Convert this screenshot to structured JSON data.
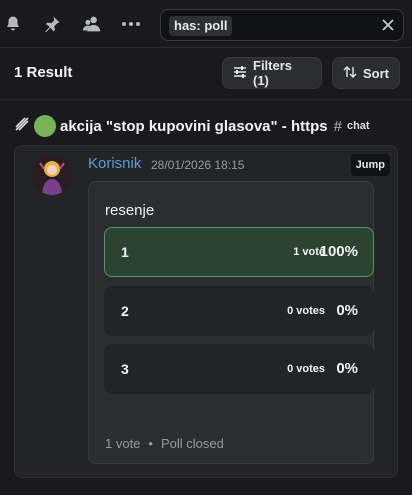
{
  "search": {
    "chip_text": "has: poll"
  },
  "results": {
    "count_label": "1 Result",
    "filters_label": "Filters (1)",
    "sort_label": "Sort"
  },
  "channel": {
    "name": "akcija \"stop kupovini glasova\" - https",
    "hash": "#",
    "tag": "chat"
  },
  "message": {
    "username": "Korisnik",
    "timestamp": "28/01/2026 18:15",
    "jump_label": "Jump",
    "poll": {
      "question": "resenje",
      "options": [
        {
          "label": "1",
          "votes": "1 vote",
          "percent": "100%",
          "winner": true
        },
        {
          "label": "2",
          "votes": "0 votes",
          "percent": "0%",
          "winner": false
        },
        {
          "label": "3",
          "votes": "0 votes",
          "percent": "0%",
          "winner": false
        }
      ],
      "total_votes": "1 vote",
      "separator": "•",
      "status": "Poll closed"
    }
  },
  "colors": {
    "accent_green": "#77b255",
    "winner_border": "#4f9a5d",
    "username": "#5b9bd5"
  },
  "icons": [
    "bell-icon",
    "pin-icon",
    "members-icon",
    "more-icon",
    "close-icon",
    "sliders-icon",
    "sort-icon",
    "thread-icon"
  ]
}
